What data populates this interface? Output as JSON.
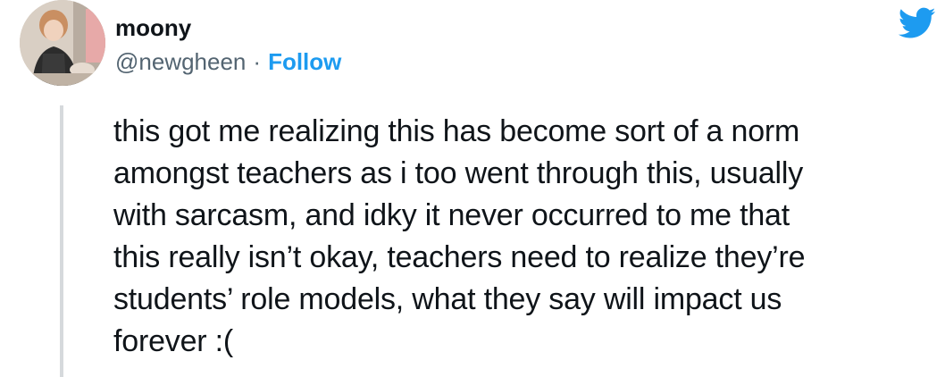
{
  "author": {
    "display_name": "moony",
    "handle": "@newgheen",
    "separator": "·",
    "follow_label": "Follow",
    "avatar_icon": "profile-photo"
  },
  "brand": {
    "logo_icon": "twitter-bird-icon",
    "color": "#1d9bf0"
  },
  "tweet": {
    "text": "this got me realizing this has become sort of a norm\namongst teachers as i too went through this, usually\nwith sarcasm, and idky it never occurred to me that\nthis really isn’t okay, teachers need to realize they’re\nstudents’ role models, what they say will impact us\nforever :("
  }
}
